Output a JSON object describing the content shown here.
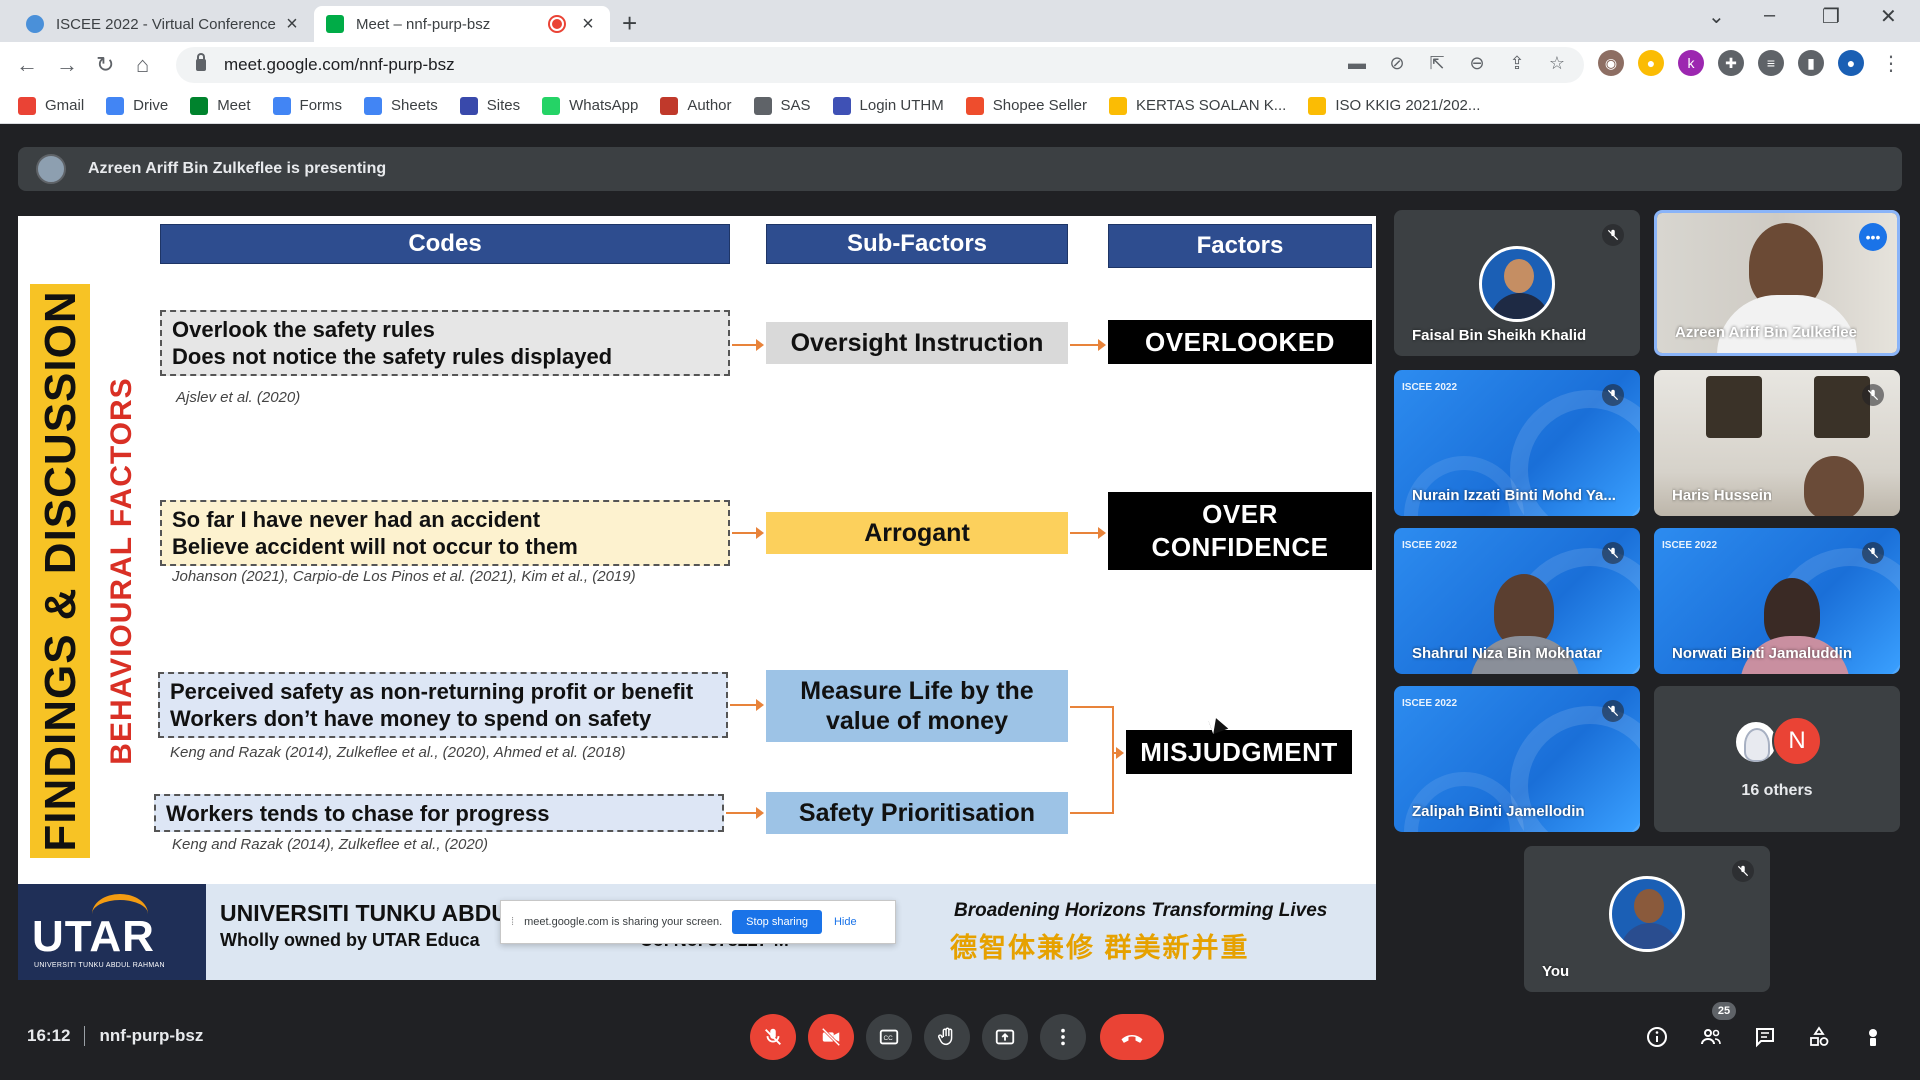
{
  "browser": {
    "tabs": [
      {
        "title": "ISCEE 2022 - Virtual Conference",
        "active": false
      },
      {
        "title": "Meet – nnf-purp-bsz",
        "active": true
      }
    ],
    "url": "meet.google.com/nnf-purp-bsz",
    "bookmarks": [
      {
        "label": "Gmail",
        "icon": "gmail-icon",
        "color": "#ea4335"
      },
      {
        "label": "Drive",
        "icon": "google-icon",
        "color": "#4285f4"
      },
      {
        "label": "Meet",
        "icon": "meet-icon",
        "color": "#00832d"
      },
      {
        "label": "Forms",
        "icon": "google-icon",
        "color": "#4285f4"
      },
      {
        "label": "Sheets",
        "icon": "google-icon",
        "color": "#4285f4"
      },
      {
        "label": "Sites",
        "icon": "sites-icon",
        "color": "#3949ab"
      },
      {
        "label": "WhatsApp",
        "icon": "whatsapp-icon",
        "color": "#25d366"
      },
      {
        "label": "Author",
        "icon": "author-icon",
        "color": "#c0392b"
      },
      {
        "label": "SAS",
        "icon": "globe-icon",
        "color": "#5f6368"
      },
      {
        "label": "Login UTHM",
        "icon": "shield-icon",
        "color": "#3f51b5"
      },
      {
        "label": "Shopee Seller",
        "icon": "shopee-icon",
        "color": "#ee4d2d"
      },
      {
        "label": "KERTAS SOALAN K...",
        "icon": "drive-icon",
        "color": "#fbbc04"
      },
      {
        "label": "ISO KKIG 2021/202...",
        "icon": "drive-icon",
        "color": "#fbbc04"
      }
    ]
  },
  "meet": {
    "presenting": "Azreen Ariff Bin Zulkeflee is presenting",
    "time": "16:12",
    "meeting_code": "nnf-purp-bsz",
    "participant_count": "25",
    "others_label": "16 others",
    "others_initial": "N",
    "participants": [
      {
        "name": "Faisal Bin Sheikh Khalid"
      },
      {
        "name": "Azreen Ariff Bin Zulkeflee"
      },
      {
        "name": "Nurain Izzati Binti Mohd Ya..."
      },
      {
        "name": "Haris Hussein"
      },
      {
        "name": "Shahrul Niza Bin Mokhatar"
      },
      {
        "name": "Norwati Binti Jamaluddin"
      },
      {
        "name": "Zalipah Binti Jamellodin"
      },
      {
        "name": "You"
      }
    ],
    "conference_tag": "ISCEE 2022"
  },
  "slide": {
    "headers": {
      "codes": "Codes",
      "subfactors": "Sub-Factors",
      "factors": "Factors"
    },
    "side_title": "FINDINGS & DISCUSSION",
    "side_subtitle": "BEHAVIOURAL FACTORS",
    "rows": [
      {
        "code1": "Overlook the safety rules",
        "code2": "Does not notice the safety rules displayed",
        "cite": "Ajslev et al. (2020)",
        "sub": "Oversight Instruction",
        "factor": "OVERLOOKED"
      },
      {
        "code1": "So far I have never had an accident",
        "code2": "Believe accident will not occur to them",
        "cite": "Johanson (2021), Carpio-de Los Pinos et al. (2021), Kim et al., (2019)",
        "sub": "Arrogant",
        "factor1": "OVER",
        "factor2": "CONFIDENCE"
      },
      {
        "code1": "Perceived safety as non-returning profit or benefit",
        "code2": "Workers don’t have money to spend on safety",
        "cite": "Keng and Razak (2014), Zulkeflee et al., (2020), Ahmed et al. (2018)",
        "sub1": "Measure Life by the",
        "sub2": "value of money"
      },
      {
        "code1": "Workers tends to chase for progress",
        "cite": "Keng and Razak (2014), Zulkeflee et al., (2020)",
        "sub": "Safety Prioritisation",
        "factor": "MISJUDGMENT"
      }
    ],
    "footer": {
      "logo": "UTAR",
      "logo_sub": "UNIVERSITI TUNKU ABDUL RAHMAN",
      "uni_name": "UNIVERSITI TUNKU ABDU",
      "owned": "Wholly owned by UTAR Educa",
      "owned_tail": "Co. No. 578227-M",
      "motto": "Broadening Horizons  Transforming Lives",
      "motto_cn": "德智体兼修 群美新并重"
    },
    "share_popup": {
      "text": "meet.google.com is sharing your screen.",
      "stop": "Stop sharing",
      "hide": "Hide"
    }
  }
}
